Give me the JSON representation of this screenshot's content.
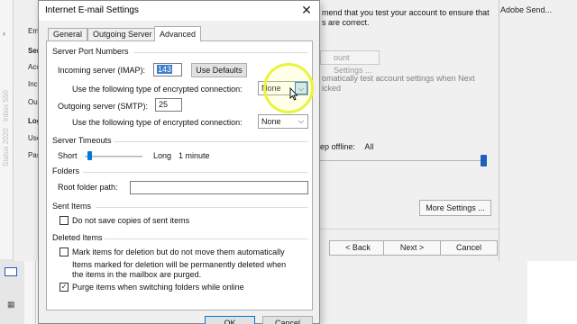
{
  "background_right": {
    "text_line1": "mend that you test your account to ensure that",
    "text_line2": "s are correct.",
    "browser_tab": "Adobe Send...",
    "test_button": "ount Settings ...",
    "auto_line1": "omatically test account settings when Next",
    "auto_line2": "icked",
    "offline_label": "ep offline:",
    "offline_value": "All",
    "more_settings": "More Settings ...",
    "back": "< Back",
    "next": "Next >",
    "cancel": "Cancel"
  },
  "background_left": {
    "vertical_text": "Status 2020 · Inbox 550",
    "labels": [
      "Ema",
      "Ser",
      "Acc",
      "Inco",
      "Out",
      "Log",
      "Use",
      "Pas"
    ]
  },
  "dialog": {
    "title": "Internet E-mail Settings",
    "tabs": [
      "General",
      "Outgoing Server",
      "Advanced"
    ],
    "active_tab": "Advanced",
    "server_ports": {
      "title": "Server Port Numbers",
      "incoming_label": "Incoming server (IMAP):",
      "incoming_value": "143",
      "use_defaults": "Use Defaults",
      "enc_label_in": "Use the following type of encrypted connection:",
      "enc_in_value": "None",
      "outgoing_label": "Outgoing server (SMTP):",
      "outgoing_value": "25",
      "enc_label_out": "Use the following type of encrypted connection:",
      "enc_out_value": "None"
    },
    "timeouts": {
      "title": "Server Timeouts",
      "short": "Short",
      "long": "Long",
      "value_text": "1 minute",
      "slider_level": 0.05
    },
    "folders": {
      "title": "Folders",
      "root_label": "Root folder path:",
      "root_value": ""
    },
    "sent_items": {
      "title": "Sent Items",
      "dont_save": "Do not save copies of sent items",
      "dont_save_checked": false
    },
    "deleted_items": {
      "title": "Deleted Items",
      "mark_label": "Mark items for deletion but do not move them automatically",
      "mark_checked": false,
      "note_line1": "Items marked for deletion will be permanently deleted when",
      "note_line2": "the items in the mailbox are purged.",
      "purge_label": "Purge items when switching folders while online",
      "purge_checked": true
    },
    "ok": "OK",
    "cancel": "Cancel"
  },
  "colors": {
    "accent": "#0078d7",
    "cursor_highlight": "#eef23a"
  }
}
